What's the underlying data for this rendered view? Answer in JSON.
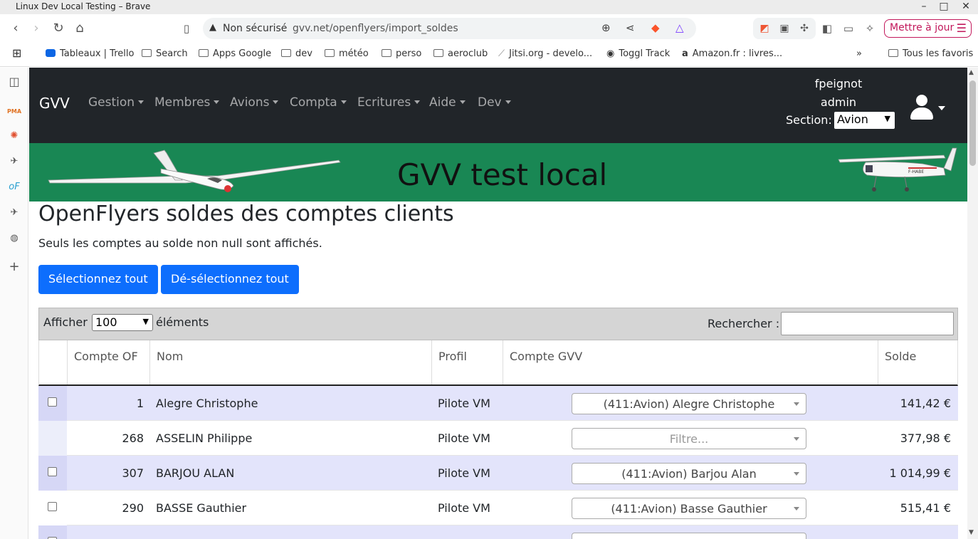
{
  "window": {
    "title": "Linux Dev Local Testing – Brave"
  },
  "browser": {
    "not_secure_label": "Non sécurisé",
    "url": "gvv.net/openflyers/import_soldes",
    "update_button": "Mettre à jour"
  },
  "bookmarks": [
    {
      "label": "Tableaux | Trello"
    },
    {
      "label": "Search"
    },
    {
      "label": "Apps Google"
    },
    {
      "label": "dev"
    },
    {
      "label": "météo"
    },
    {
      "label": "perso"
    },
    {
      "label": "aeroclub"
    },
    {
      "label": "Jitsi.org - develo..."
    },
    {
      "label": "Toggl Track"
    },
    {
      "label": "Amazon.fr : livres..."
    },
    {
      "label": "Tous les favoris"
    }
  ],
  "sidebar_icons": [
    "pma-icon",
    "sun-icon",
    "plane-icon",
    "openflyers-icon",
    "plane-icon-2",
    "globe-icon",
    "add-icon"
  ],
  "navbar": {
    "brand": "GVV",
    "menu": [
      {
        "label": "Gestion"
      },
      {
        "label": "Membres"
      },
      {
        "label": "Avions"
      },
      {
        "label": "Compta"
      },
      {
        "label": "Ecritures"
      },
      {
        "label": "Aide"
      },
      {
        "label": "Dev"
      }
    ],
    "user": "fpeignot",
    "role": "admin",
    "section_label": "Section:",
    "section_value": "Avion"
  },
  "banner": {
    "title": "GVV test local"
  },
  "page": {
    "title": "OpenFlyers soldes des comptes clients",
    "subtitle": "Seuls les comptes au solde non null sont affichés.",
    "select_all": "Sélectionnez tout",
    "deselect_all": "Dé-sélectionnez tout"
  },
  "table": {
    "show_label": "Afficher",
    "show_value": "100",
    "elements_label": "éléments",
    "search_label": "Rechercher :",
    "columns": [
      "Compte OF",
      "Nom",
      "Profil",
      "Compte GVV",
      "Solde"
    ],
    "rows": [
      {
        "compte_of": "1",
        "nom": "Alegre Christophe",
        "profil": "Pilote VM",
        "compte_gvv": "(411:Avion) Alegre Christophe",
        "solde": "141,42 €",
        "checkbox": true
      },
      {
        "compte_of": "268",
        "nom": "ASSELIN Philippe",
        "profil": "Pilote VM",
        "compte_gvv": "Filtre...",
        "solde": "377,98 €",
        "checkbox": false
      },
      {
        "compte_of": "307",
        "nom": "BARJOU ALAN",
        "profil": "Pilote VM",
        "compte_gvv": "(411:Avion) Barjou Alan",
        "solde": "1 014,99 €",
        "checkbox": true
      },
      {
        "compte_of": "290",
        "nom": "BASSE Gauthier",
        "profil": "Pilote VM",
        "compte_gvv": "(411:Avion) Basse Gauthier",
        "solde": "515,41 €",
        "checkbox": true
      }
    ]
  },
  "colors": {
    "navbar": "#212529",
    "banner": "#198754",
    "primary": "#0d6efd",
    "row_highlight": "#e3e4fb"
  }
}
